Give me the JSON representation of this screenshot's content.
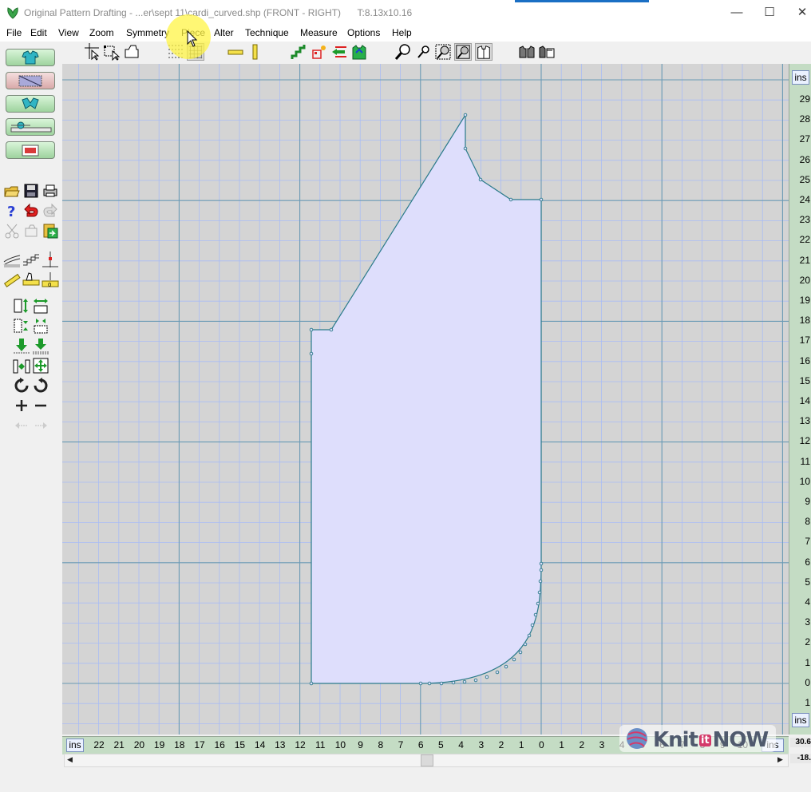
{
  "window": {
    "title": "Original Pattern Drafting - ...er\\sept 11\\cardi_curved.shp (FRONT - RIGHT)",
    "size_info": "T:8.13x10.16",
    "minimize": "—",
    "maximize": "☐",
    "close": "✕"
  },
  "menu": [
    "File",
    "Edit",
    "View",
    "Zoom",
    "Symmetry",
    "Piece",
    "Alter",
    "Technique",
    "Measure",
    "Options",
    "Help"
  ],
  "colors": {
    "canvas_bg": "#d4d4d4",
    "grid_minor": "#a9bcf5",
    "grid_major": "#6a9ab5",
    "piece_fill": "#dedefc",
    "piece_stroke": "#2a7a8a",
    "ruler_bg": "#c4dcc4"
  },
  "rulers": {
    "unit_label": "ins",
    "vertical_labels": [
      "29",
      "28",
      "27",
      "26",
      "25",
      "24",
      "23",
      "22",
      "21",
      "20",
      "19",
      "18",
      "17",
      "16",
      "15",
      "14",
      "13",
      "12",
      "11",
      "10",
      "9",
      "8",
      "7",
      "6",
      "5",
      "4",
      "3",
      "2",
      "1",
      "0",
      "1"
    ],
    "horizontal_labels": [
      "22",
      "21",
      "20",
      "19",
      "18",
      "17",
      "16",
      "15",
      "14",
      "13",
      "12",
      "11",
      "10",
      "9",
      "8",
      "7",
      "6",
      "5",
      "4",
      "3",
      "2",
      "1",
      "0",
      "1",
      "2",
      "3",
      "4",
      "5",
      "6",
      "7",
      "8",
      "9",
      "10",
      "11"
    ],
    "coord_a": "30.6",
    "coord_b": "-18."
  },
  "logo": {
    "knit": "Knit",
    "it": "it",
    "now": "NOW"
  }
}
